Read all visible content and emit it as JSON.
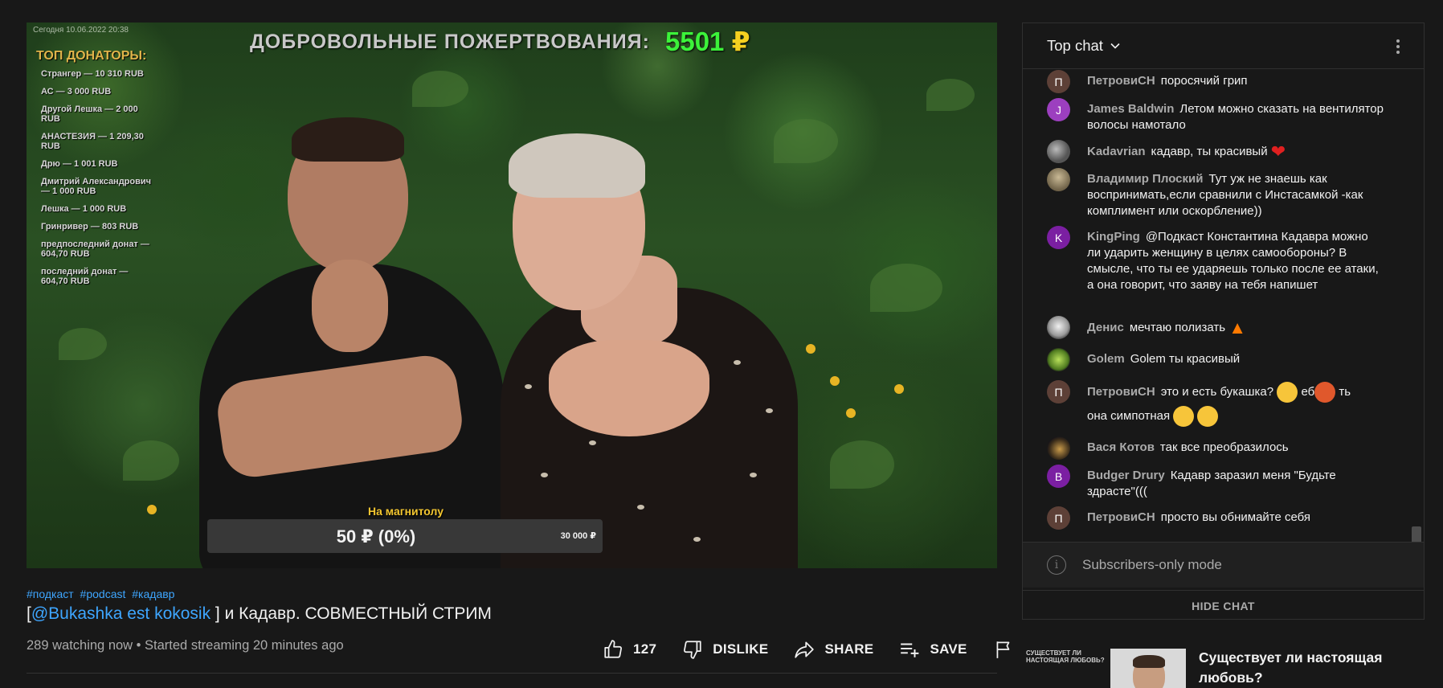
{
  "video": {
    "overlay_timestamp": "Сегодня 10.06.2022  20:38",
    "donations_label": "ДОБРОВОЛЬНЫЕ ПОЖЕРТВОВАНИЯ:",
    "donations_amount": "5501",
    "donations_currency": "₽",
    "top_donors_title": "ТОП ДОНАТОРЫ:",
    "top_donors": [
      "Странгер — 10 310 RUB",
      "АС — 3 000 RUB",
      "Другой Лешка — 2 000 RUB",
      "АНАСТЕЗИЯ — 1 209,30 RUB",
      "Дрю — 1 001 RUB",
      "Дмитрий Александрович — 1 000 RUB",
      "Лешка — 1 000 RUB",
      "Гринривер — 803 RUB",
      "предпоследний донат — 604,70 RUB",
      "последний донат — 604,70 RUB"
    ],
    "goal_caption": "На магнитолу",
    "goal_value": "50 ₽ (0%)",
    "goal_progress": 0,
    "goal_target": "30 000 ₽"
  },
  "info": {
    "hashtags": [
      "#подкаст",
      "#podcast",
      "#кадавр"
    ],
    "title_prefix": "[",
    "title_mention": "@Bukashka est kokosik",
    "title_suffix": " ] и Кадавр. СОВМЕСТНЫЙ СТРИМ",
    "meta": "289 watching now • Started streaming 20 minutes ago",
    "like_count": "127",
    "dislike_label": "DISLIKE",
    "share_label": "SHARE",
    "save_label": "SAVE"
  },
  "chat": {
    "header_title": "Top chat",
    "messages": [
      {
        "author": "ПетровиСН",
        "initial": "П",
        "avatar_color": "#5d4037",
        "text": "поросячий грип"
      },
      {
        "author": "James Baldwin",
        "initial": "J",
        "avatar_color": "#8e44ad",
        "text": "Летом можно сказать на вентилятор волосы намотало"
      },
      {
        "author": "Kadavrian",
        "initial": "",
        "avatar_color": "#6b6b6b",
        "text": "кадавр, ты красивый"
      },
      {
        "author": "Владимир Плоский",
        "initial": "",
        "avatar_color": "#8a7a62",
        "text": "Тут уж не знаешь как воспринимать,если сравнили с Инстасамкой -как комплимент или оскорбление))"
      },
      {
        "author": "KingPing",
        "initial": "K",
        "avatar_color": "#6a1b9a",
        "text": "@Подкаст Константина Кадавра можно ли ударить женщину в целях самообороны? В смысле, что ты ее ударяешь только после ее атаки, а она говорит, что заяву на тебя напишет"
      },
      {
        "author": "Денис",
        "initial": "",
        "avatar_color": "#d0d0d0",
        "text": "мечтаю полизать"
      },
      {
        "author": "Golem",
        "initial": "",
        "avatar_color": "#7cb342",
        "text": "Golem ты красивый"
      },
      {
        "author": "ПетровиСН",
        "initial": "П",
        "avatar_color": "#5d4037",
        "text": "это и есть букашка?",
        "text_mid": "еб",
        "text_end": "ть",
        "text_line2": "она симпотная"
      },
      {
        "author": "Вася Котов",
        "initial": "",
        "avatar_color": "#2a2a3a",
        "text": "так все преобразилось"
      },
      {
        "author": "Budger Drury",
        "initial": "B",
        "avatar_color": "#7b1fa2",
        "text": "Кадавр заразил меня \"Будьте здрасте\"((("
      },
      {
        "author": "ПетровиСН",
        "initial": "П",
        "avatar_color": "#5d4037",
        "text": "просто вы обнимайте себя"
      }
    ],
    "subscribers_only": "Subscribers-only mode",
    "hide_chat": "HIDE CHAT"
  },
  "recommendation": {
    "thumb_text": "СУЩЕСТВУЕТ ЛИ НАСТОЯЩАЯ ЛЮБОВЬ?",
    "title": "Существует ли настоящая любовь?"
  }
}
